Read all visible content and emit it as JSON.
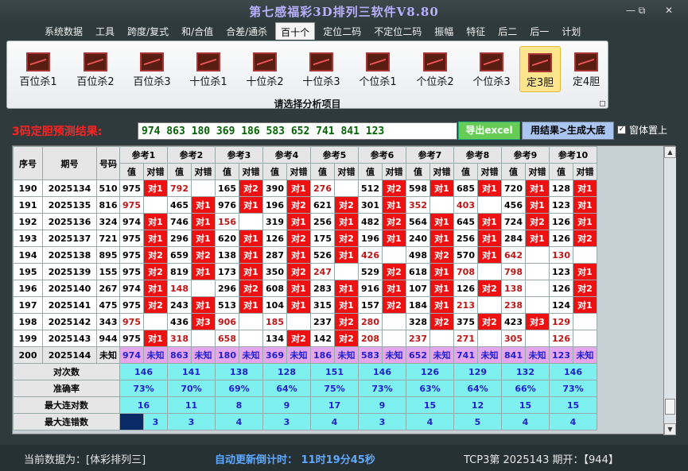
{
  "window": {
    "title": "第七感福彩3D排列三软件V8.80",
    "controls": [
      "—",
      "⧉",
      "✕"
    ]
  },
  "menu": {
    "items": [
      "系统数据",
      "工具",
      "跨度/复式",
      "和/合值",
      "合差/通杀",
      "百十个",
      "定位二码",
      "不定位二码",
      "振幅",
      "特征",
      "后二",
      "后一",
      "计划"
    ],
    "active_index": 5
  },
  "ribbon": {
    "buttons": [
      "百位杀1",
      "百位杀2",
      "百位杀3",
      "十位杀1",
      "十位杀2",
      "十位杀3",
      "个位杀1",
      "个位杀2",
      "个位杀3",
      "定3胆",
      "定4胆"
    ],
    "selected_index": 9,
    "caption": "请选择分析项目"
  },
  "prediction": {
    "label": "3码定胆预测结果:",
    "value": "974 863 180 369 186 583 652 741 841 123",
    "excel_button": "导出excel",
    "generate_button": "用结果>生成大底",
    "ontop_label": "窗体置上",
    "ontop_checked": true
  },
  "table": {
    "header_left": [
      "序号",
      "期号",
      "号码"
    ],
    "groups": [
      "参考1",
      "参考2",
      "参考3",
      "参考4",
      "参考5",
      "参考6",
      "参考7",
      "参考8",
      "参考9",
      "参考10"
    ],
    "sub_headers": [
      "值",
      "对错"
    ],
    "rows": [
      {
        "seq": "190",
        "period": "2025134",
        "num": "510",
        "cells": [
          [
            "975",
            "对1",
            1,
            0
          ],
          [
            "792",
            "",
            0,
            1
          ],
          [
            "165",
            "对2",
            1,
            0
          ],
          [
            "390",
            "对1",
            1,
            0
          ],
          [
            "276",
            "",
            0,
            1
          ],
          [
            "512",
            "对2",
            1,
            0
          ],
          [
            "598",
            "对1",
            1,
            0
          ],
          [
            "685",
            "对1",
            1,
            0
          ],
          [
            "720",
            "对1",
            1,
            0
          ],
          [
            "128",
            "对1",
            1,
            0
          ]
        ]
      },
      {
        "seq": "191",
        "period": "2025135",
        "num": "816",
        "cells": [
          [
            "975",
            "",
            0,
            1
          ],
          [
            "465",
            "对1",
            1,
            0
          ],
          [
            "976",
            "对1",
            1,
            0
          ],
          [
            "196",
            "对2",
            1,
            0
          ],
          [
            "621",
            "对2",
            1,
            0
          ],
          [
            "301",
            "对1",
            1,
            0
          ],
          [
            "352",
            "",
            0,
            1
          ],
          [
            "403",
            "",
            0,
            1
          ],
          [
            "456",
            "对1",
            1,
            0
          ],
          [
            "123",
            "对1",
            1,
            0
          ]
        ]
      },
      {
        "seq": "192",
        "period": "2025136",
        "num": "324",
        "cells": [
          [
            "974",
            "对1",
            1,
            0
          ],
          [
            "746",
            "对1",
            1,
            0
          ],
          [
            "156",
            "",
            0,
            1
          ],
          [
            "319",
            "对1",
            1,
            0
          ],
          [
            "256",
            "对1",
            1,
            0
          ],
          [
            "482",
            "对2",
            1,
            0
          ],
          [
            "564",
            "对1",
            1,
            0
          ],
          [
            "645",
            "对1",
            1,
            0
          ],
          [
            "724",
            "对2",
            1,
            0
          ],
          [
            "126",
            "对1",
            1,
            0
          ]
        ]
      },
      {
        "seq": "193",
        "period": "2025137",
        "num": "721",
        "cells": [
          [
            "975",
            "对1",
            1,
            0
          ],
          [
            "296",
            "对1",
            1,
            0
          ],
          [
            "620",
            "对1",
            1,
            0
          ],
          [
            "126",
            "对2",
            1,
            0
          ],
          [
            "175",
            "对2",
            1,
            0
          ],
          [
            "196",
            "对1",
            1,
            0
          ],
          [
            "240",
            "对1",
            1,
            0
          ],
          [
            "256",
            "对1",
            1,
            0
          ],
          [
            "284",
            "对1",
            1,
            0
          ],
          [
            "126",
            "对2",
            1,
            0
          ]
        ]
      },
      {
        "seq": "194",
        "period": "2025138",
        "num": "895",
        "cells": [
          [
            "975",
            "对2",
            1,
            0
          ],
          [
            "659",
            "对2",
            1,
            0
          ],
          [
            "138",
            "对1",
            1,
            0
          ],
          [
            "287",
            "对1",
            1,
            0
          ],
          [
            "526",
            "对1",
            1,
            0
          ],
          [
            "426",
            "",
            0,
            1
          ],
          [
            "498",
            "对2",
            1,
            0
          ],
          [
            "570",
            "对1",
            1,
            0
          ],
          [
            "642",
            "",
            0,
            1
          ],
          [
            "130",
            "",
            0,
            1
          ]
        ]
      },
      {
        "seq": "195",
        "period": "2025139",
        "num": "155",
        "cells": [
          [
            "975",
            "对2",
            1,
            0
          ],
          [
            "819",
            "对1",
            1,
            0
          ],
          [
            "173",
            "对1",
            1,
            0
          ],
          [
            "350",
            "对2",
            1,
            0
          ],
          [
            "247",
            "",
            0,
            1
          ],
          [
            "529",
            "对2",
            1,
            0
          ],
          [
            "618",
            "对1",
            1,
            0
          ],
          [
            "708",
            "",
            0,
            1
          ],
          [
            "798",
            "",
            0,
            1
          ],
          [
            "123",
            "对1",
            1,
            0
          ]
        ]
      },
      {
        "seq": "196",
        "period": "2025140",
        "num": "267",
        "cells": [
          [
            "974",
            "对1",
            1,
            0
          ],
          [
            "148",
            "",
            0,
            1
          ],
          [
            "296",
            "对2",
            1,
            0
          ],
          [
            "608",
            "对1",
            1,
            0
          ],
          [
            "283",
            "对1",
            1,
            0
          ],
          [
            "916",
            "对1",
            1,
            0
          ],
          [
            "107",
            "对1",
            1,
            0
          ],
          [
            "126",
            "对2",
            1,
            0
          ],
          [
            "138",
            "",
            0,
            1
          ],
          [
            "126",
            "对2",
            1,
            0
          ]
        ]
      },
      {
        "seq": "197",
        "period": "2025141",
        "num": "475",
        "cells": [
          [
            "975",
            "对2",
            1,
            0
          ],
          [
            "243",
            "对1",
            1,
            0
          ],
          [
            "513",
            "对1",
            1,
            0
          ],
          [
            "104",
            "对1",
            1,
            0
          ],
          [
            "315",
            "对1",
            1,
            0
          ],
          [
            "157",
            "对2",
            1,
            0
          ],
          [
            "184",
            "对1",
            1,
            0
          ],
          [
            "213",
            "",
            0,
            1
          ],
          [
            "238",
            "",
            0,
            1
          ],
          [
            "124",
            "对1",
            1,
            0
          ]
        ]
      },
      {
        "seq": "198",
        "period": "2025142",
        "num": "343",
        "cells": [
          [
            "975",
            "",
            0,
            1
          ],
          [
            "436",
            "对3",
            1,
            0
          ],
          [
            "906",
            "",
            0,
            1
          ],
          [
            "185",
            "",
            0,
            1
          ],
          [
            "237",
            "对2",
            1,
            0
          ],
          [
            "280",
            "",
            0,
            1
          ],
          [
            "328",
            "对2",
            1,
            0
          ],
          [
            "375",
            "对2",
            1,
            0
          ],
          [
            "423",
            "对3",
            1,
            0
          ],
          [
            "129",
            "",
            0,
            1
          ]
        ]
      },
      {
        "seq": "199",
        "period": "2025143",
        "num": "944",
        "cells": [
          [
            "975",
            "对1",
            1,
            0
          ],
          [
            "318",
            "",
            0,
            1
          ],
          [
            "658",
            "",
            0,
            1
          ],
          [
            "134",
            "对2",
            1,
            0
          ],
          [
            "142",
            "对2",
            1,
            0
          ],
          [
            "208",
            "",
            0,
            1
          ],
          [
            "237",
            "",
            0,
            1
          ],
          [
            "271",
            "",
            0,
            1
          ],
          [
            "305",
            "",
            0,
            1
          ],
          [
            "126",
            "",
            0,
            1
          ]
        ]
      }
    ],
    "future_row": {
      "seq": "200",
      "period": "2025144",
      "num": "未知",
      "values": [
        "974",
        "863",
        "180",
        "369",
        "186",
        "583",
        "652",
        "741",
        "841",
        "123"
      ],
      "status": "未知"
    },
    "stats": [
      {
        "label": "对次数",
        "values": [
          "146",
          "141",
          "138",
          "128",
          "151",
          "146",
          "126",
          "129",
          "132",
          "146"
        ],
        "left_navy": false
      },
      {
        "label": "准确率",
        "values": [
          "73%",
          "70%",
          "69%",
          "64%",
          "75%",
          "73%",
          "63%",
          "64%",
          "66%",
          "73%"
        ],
        "left_navy": false
      },
      {
        "label": "最大连对数",
        "values": [
          "16",
          "11",
          "8",
          "9",
          "17",
          "9",
          "15",
          "12",
          "15",
          "15"
        ],
        "left_navy": false
      },
      {
        "label": "最大连错数",
        "values": [
          "3",
          "3",
          "4",
          "3",
          "4",
          "3",
          "4",
          "5",
          "4",
          "4"
        ],
        "left_navy": true
      }
    ]
  },
  "status": {
    "data_source": "当前数据为：[体彩排列三]",
    "countdown": "自动更新倒计时：  11时19分45秒",
    "issue": "TCP3第 2025143 期开：【944】"
  }
}
